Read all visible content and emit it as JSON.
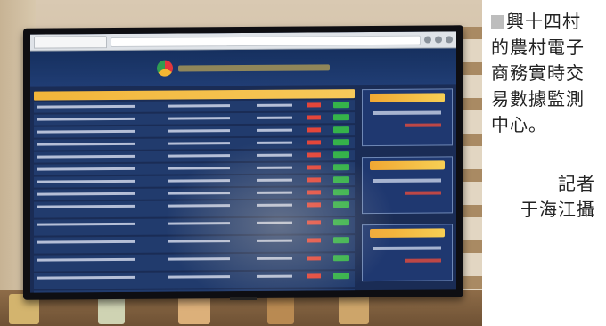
{
  "photo": {
    "subject": "monitor-displaying-dashboard",
    "screen_colors": {
      "background": "#1a2c55",
      "header": "#f2b53a",
      "highlight_red": "#e3463a",
      "highlight_green": "#35b34a"
    }
  },
  "caption": {
    "text": "興十四村的農村電子商務實時交易數據監測中心。",
    "credit_role": "記者",
    "credit_name": "于海江攝",
    "marker_color": "#bdbdbd"
  }
}
